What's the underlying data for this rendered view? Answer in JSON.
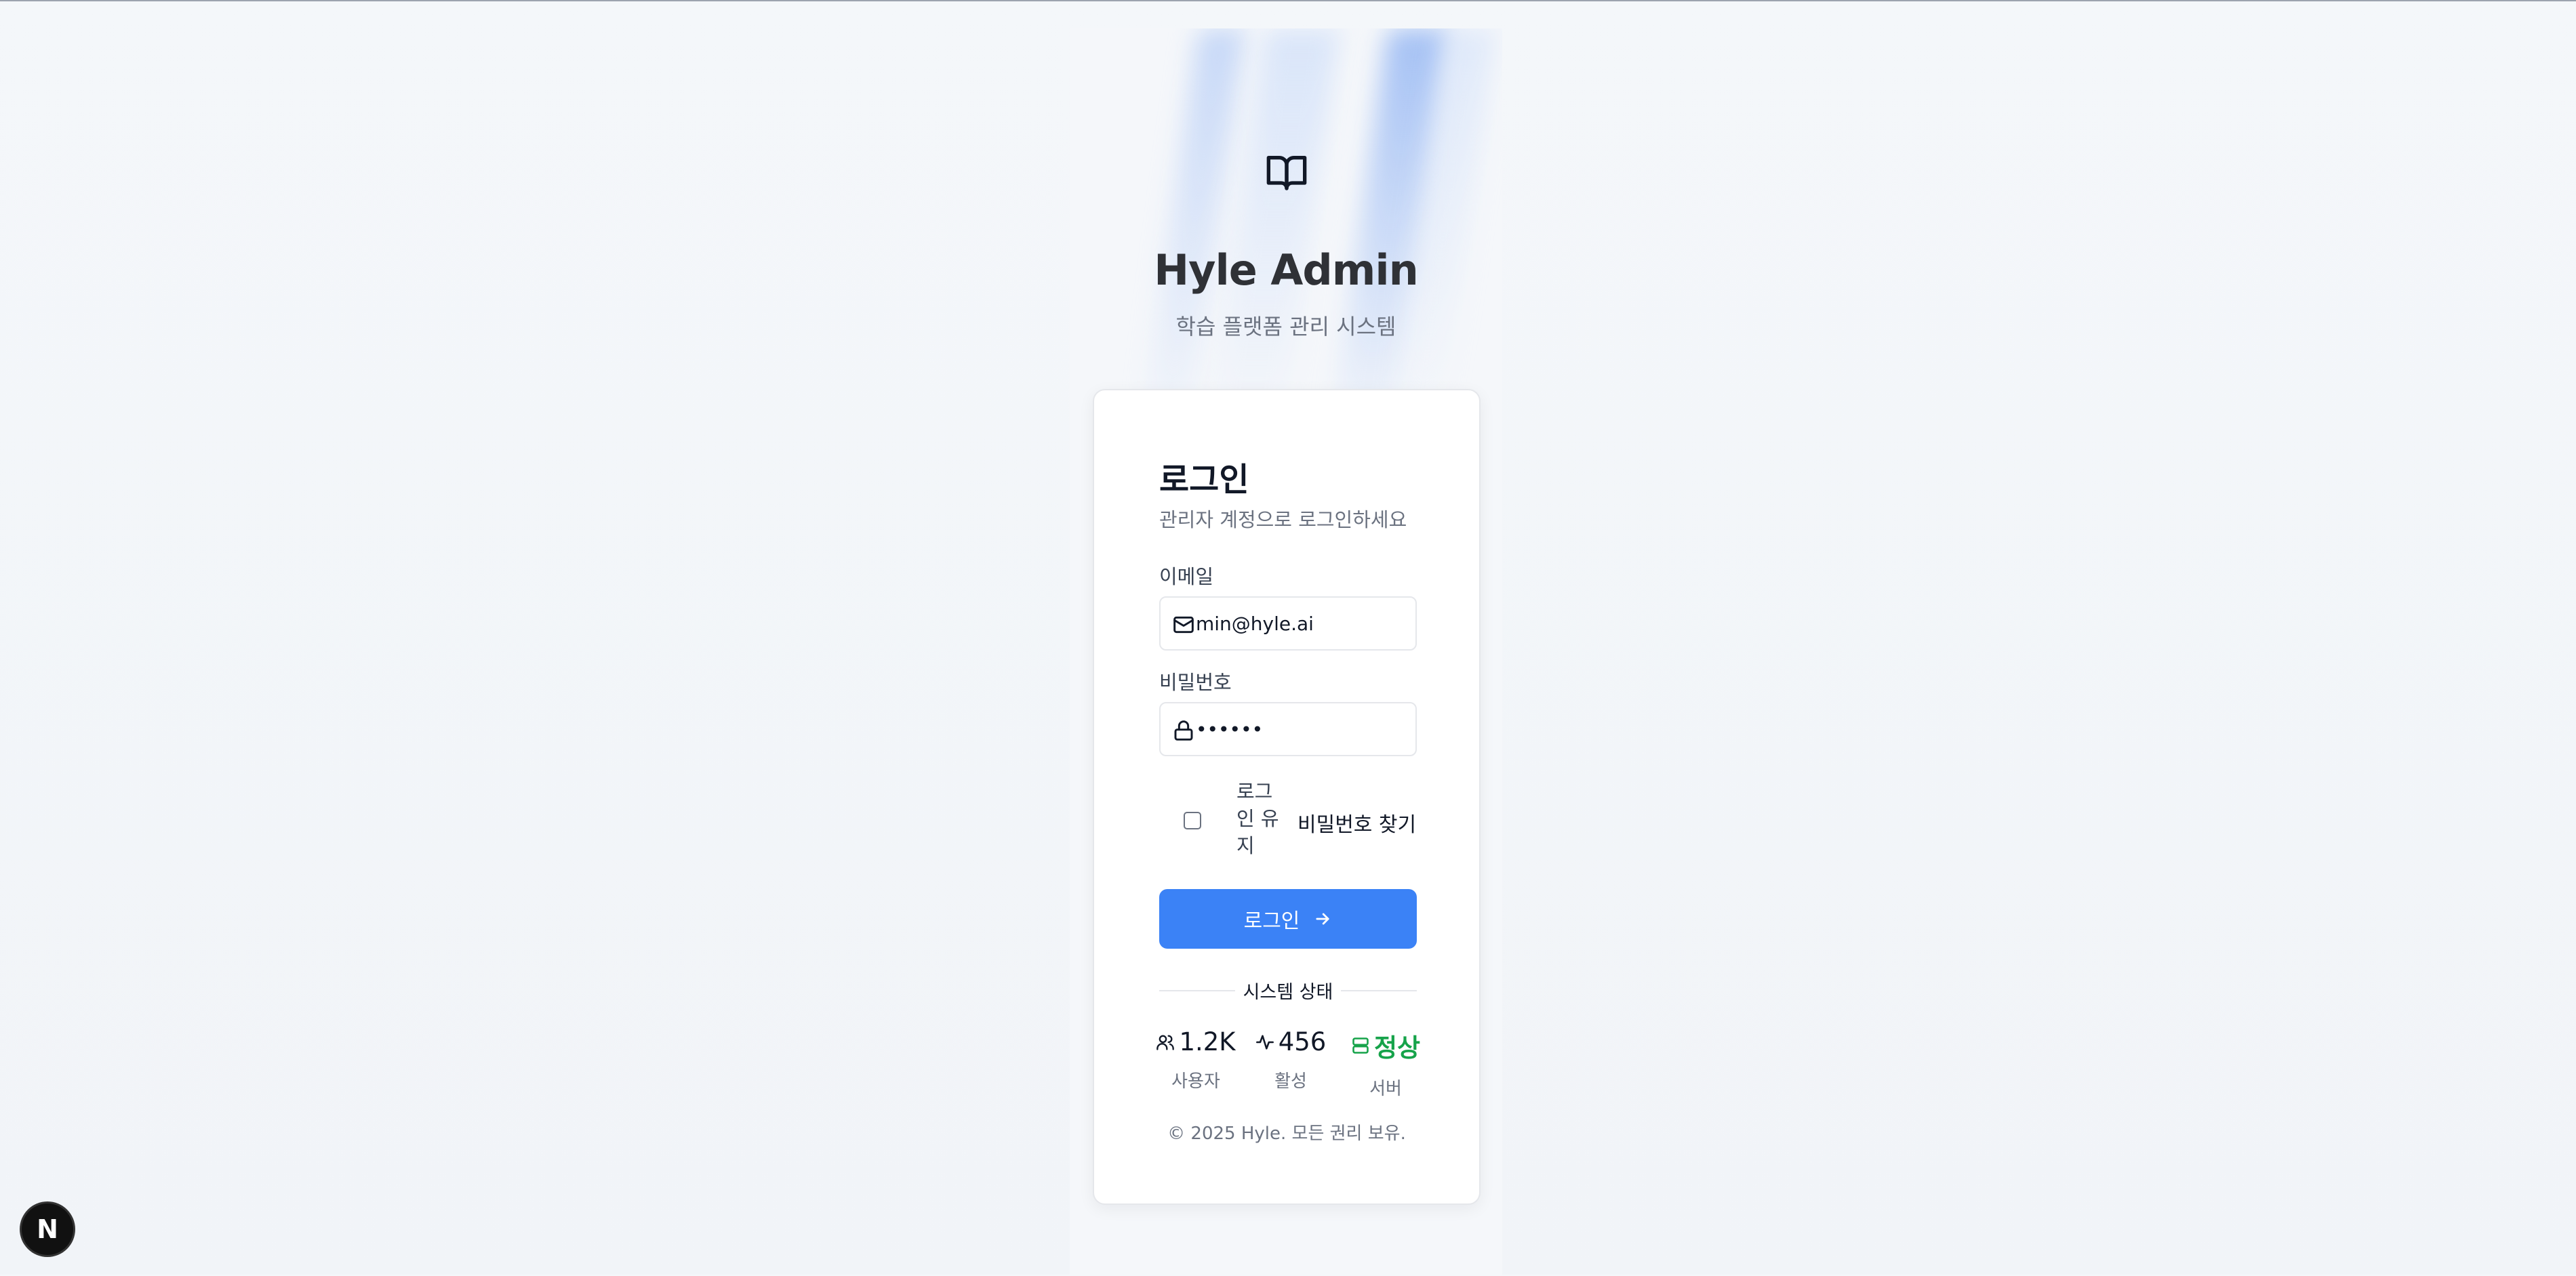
{
  "brand": {
    "title": "Hyle Admin",
    "subtitle": "학습 플랫폼 관리 시스템",
    "icon": "book-open-icon"
  },
  "login": {
    "heading": "로그인",
    "description": "관리자 계정으로 로그인하세요",
    "email_label": "이메일",
    "email_value": "min@hyle.ai",
    "password_label": "비밀번호",
    "password_value": "••••••",
    "remember_label": "로그인 유지",
    "remember_checked": false,
    "forgot_password": "비밀번호 찾기",
    "submit_label": "로그인"
  },
  "status": {
    "heading": "시스템 상태",
    "stats": [
      {
        "value": "1.2K",
        "caption": "사용자",
        "icon": "users-icon"
      },
      {
        "value": "456",
        "caption": "활성",
        "icon": "activity-icon"
      },
      {
        "value": "정상",
        "caption": "서버",
        "icon": "server-icon"
      }
    ]
  },
  "footer": {
    "copyright": "© 2025 Hyle. 모든 권리 보유."
  },
  "dev_badge": {
    "label": "N",
    "icon": "nextjs-logo-icon"
  },
  "colors": {
    "primary": "#3b82f6",
    "success": "#16a34a",
    "background": "#f4f7fa"
  }
}
